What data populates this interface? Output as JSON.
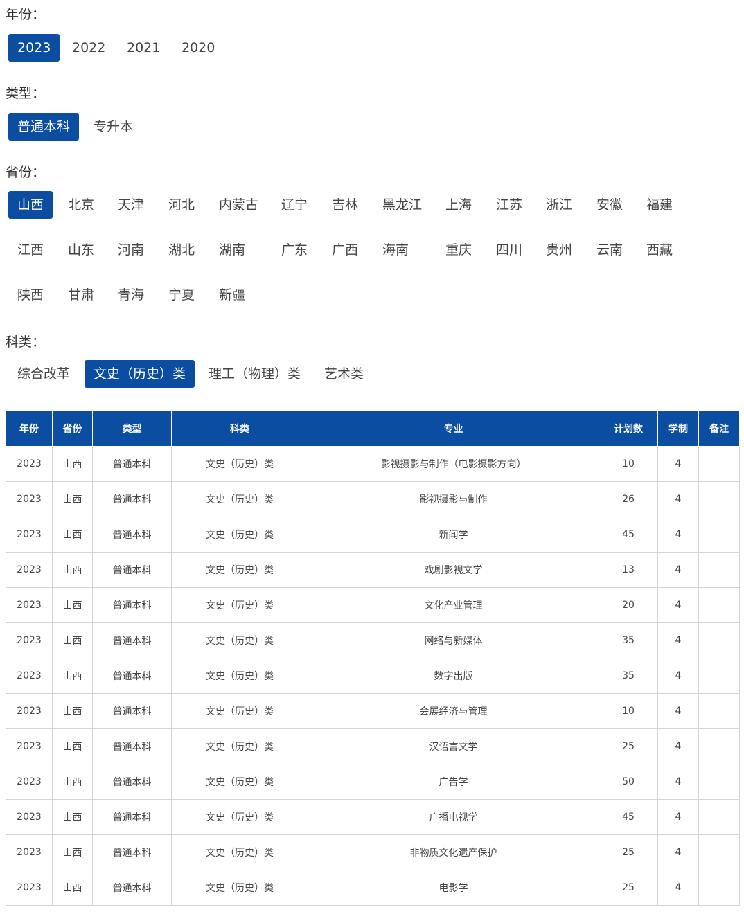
{
  "year": {
    "label": "年份：",
    "options": [
      "2023",
      "2022",
      "2021",
      "2020"
    ],
    "selected": 0
  },
  "type": {
    "label": "类型：",
    "options": [
      "普通本科",
      "专升本"
    ],
    "selected": 0
  },
  "province": {
    "label": "省份：",
    "options": [
      "山西",
      "北京",
      "天津",
      "河北",
      "内蒙古",
      "辽宁",
      "吉林",
      "黑龙江",
      "上海",
      "江苏",
      "浙江",
      "安徽",
      "福建",
      "江西",
      "山东",
      "河南",
      "湖北",
      "湖南",
      "广东",
      "广西",
      "海南",
      "重庆",
      "四川",
      "贵州",
      "云南",
      "西藏",
      "陕西",
      "甘肃",
      "青海",
      "宁夏",
      "新疆"
    ],
    "selected": 0
  },
  "category": {
    "label": "科类：",
    "options": [
      "综合改革",
      "文史（历史）类",
      "理工（物理）类",
      "艺术类"
    ],
    "selected": 1
  },
  "colors": {
    "accent": "#0b4da0"
  },
  "table": {
    "headers": [
      "年份",
      "省份",
      "类型",
      "科类",
      "专业",
      "计划数",
      "学制",
      "备注"
    ],
    "rows": [
      [
        "2023",
        "山西",
        "普通本科",
        "文史（历史）类",
        "影视摄影与制作（电影摄影方向）",
        "10",
        "4",
        ""
      ],
      [
        "2023",
        "山西",
        "普通本科",
        "文史（历史）类",
        "影视摄影与制作",
        "26",
        "4",
        ""
      ],
      [
        "2023",
        "山西",
        "普通本科",
        "文史（历史）类",
        "新闻学",
        "45",
        "4",
        ""
      ],
      [
        "2023",
        "山西",
        "普通本科",
        "文史（历史）类",
        "戏剧影视文学",
        "13",
        "4",
        ""
      ],
      [
        "2023",
        "山西",
        "普通本科",
        "文史（历史）类",
        "文化产业管理",
        "20",
        "4",
        ""
      ],
      [
        "2023",
        "山西",
        "普通本科",
        "文史（历史）类",
        "网络与新媒体",
        "35",
        "4",
        ""
      ],
      [
        "2023",
        "山西",
        "普通本科",
        "文史（历史）类",
        "数字出版",
        "35",
        "4",
        ""
      ],
      [
        "2023",
        "山西",
        "普通本科",
        "文史（历史）类",
        "会展经济与管理",
        "10",
        "4",
        ""
      ],
      [
        "2023",
        "山西",
        "普通本科",
        "文史（历史）类",
        "汉语言文学",
        "25",
        "4",
        ""
      ],
      [
        "2023",
        "山西",
        "普通本科",
        "文史（历史）类",
        "广告学",
        "50",
        "4",
        ""
      ],
      [
        "2023",
        "山西",
        "普通本科",
        "文史（历史）类",
        "广播电视学",
        "45",
        "4",
        ""
      ],
      [
        "2023",
        "山西",
        "普通本科",
        "文史（历史）类",
        "非物质文化遗产保护",
        "25",
        "4",
        ""
      ],
      [
        "2023",
        "山西",
        "普通本科",
        "文史（历史）类",
        "电影学",
        "25",
        "4",
        ""
      ]
    ]
  }
}
